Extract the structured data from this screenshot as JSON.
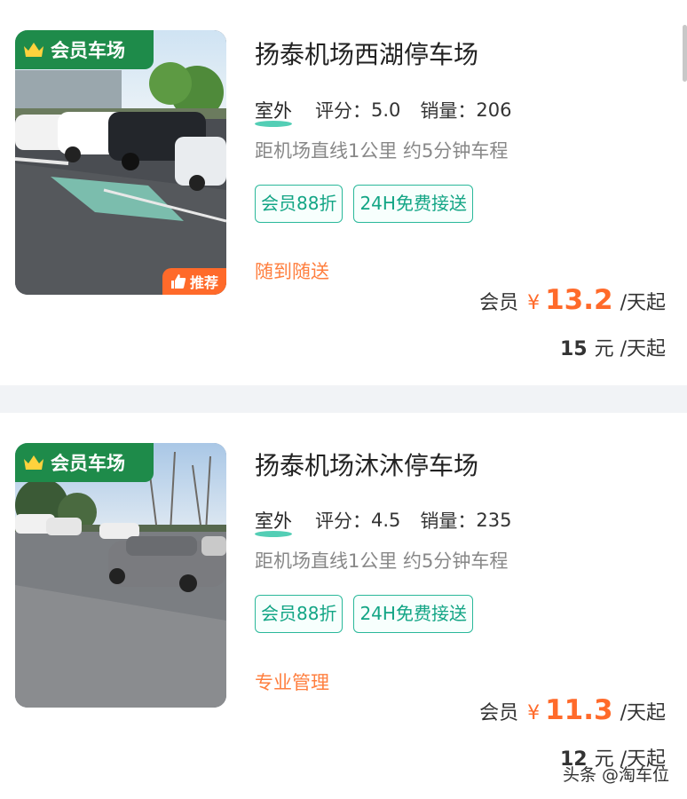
{
  "colors": {
    "member_badge": "#1e8b4a",
    "accent_price": "#ff6a2a",
    "chip_border": "#2ab89a",
    "note_text": "#ff7f3f"
  },
  "listings": [
    {
      "badge": "会员车场",
      "recommend_badge": "推荐",
      "name": "扬泰机场西湖停车场",
      "type": "室外",
      "rating_label": "评分：",
      "rating": "5.0",
      "sales_label": "销量：",
      "sales": "206",
      "distance": "距机场直线1公里 约5分钟车程",
      "chips": [
        "会员88折",
        "24H免费接送"
      ],
      "note": "随到随送",
      "member_label": "会员",
      "currency": "¥",
      "member_price": "13.2",
      "unit": "/天起",
      "regular_price": "15",
      "regular_unit": "元 /天起"
    },
    {
      "badge": "会员车场",
      "name": "扬泰机场沐沐停车场",
      "type": "室外",
      "rating_label": "评分：",
      "rating": "4.5",
      "sales_label": "销量：",
      "sales": "235",
      "distance": "距机场直线1公里 约5分钟车程",
      "chips": [
        "会员88折",
        "24H免费接送"
      ],
      "note": "专业管理",
      "member_label": "会员",
      "currency": "¥",
      "member_price": "11.3",
      "unit": "/天起",
      "regular_price": "12",
      "regular_unit": "元 /天起"
    }
  ],
  "watermark": "头条 @淘车位"
}
